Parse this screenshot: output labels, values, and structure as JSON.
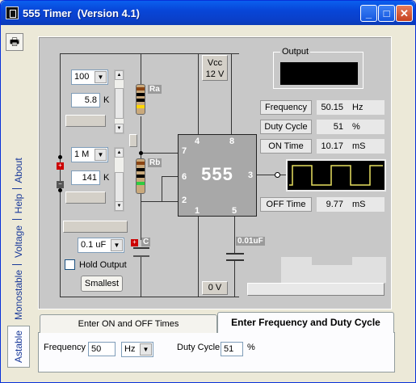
{
  "window": {
    "title": "555 Timer  (Version 4.1)"
  },
  "side_tabs": [
    "About",
    "Help",
    "Voltage",
    "Monostable",
    "Astable"
  ],
  "circuit": {
    "vcc_label": "Vcc",
    "vcc_value": "12 V",
    "ground_label": "0 V",
    "chip_label": "555",
    "pins": [
      "7",
      "4",
      "8",
      "6",
      "3",
      "2",
      "1",
      "5"
    ],
    "ra": {
      "tag": "Ra",
      "multiplier": "100",
      "value": "5.8",
      "unit": "K"
    },
    "rb": {
      "tag": "Rb",
      "multiplier": "1 M",
      "value": "141",
      "unit": "K"
    },
    "c": {
      "tag": "C",
      "value": "0.1 uF"
    },
    "c_control": {
      "tag": "0.01uF"
    },
    "hold_output_label": "Hold Output",
    "smallest_button": "Smallest",
    "output_label": "Output"
  },
  "readouts": {
    "frequency": {
      "label": "Frequency",
      "value": "50.15",
      "unit": "Hz"
    },
    "duty_cycle": {
      "label": "Duty Cycle",
      "value": "51",
      "unit": "%"
    },
    "on_time": {
      "label": "ON Time",
      "value": "10.17",
      "unit": "mS"
    },
    "off_time": {
      "label": "OFF Time",
      "value": "9.77",
      "unit": "mS"
    }
  },
  "bottom": {
    "tab1": "Enter ON and OFF Times",
    "tab2": "Enter Frequency and Duty Cycle",
    "freq_label": "Frequency",
    "freq_value": "50",
    "freq_unit": "Hz",
    "duty_label": "Duty Cycle",
    "duty_value": "51",
    "duty_unit": "%"
  },
  "colors": {
    "title_bar": "#0846d8",
    "panel": "#c8c8c8",
    "chip": "#a8a8a8",
    "scope_trace": "#e8e060"
  }
}
